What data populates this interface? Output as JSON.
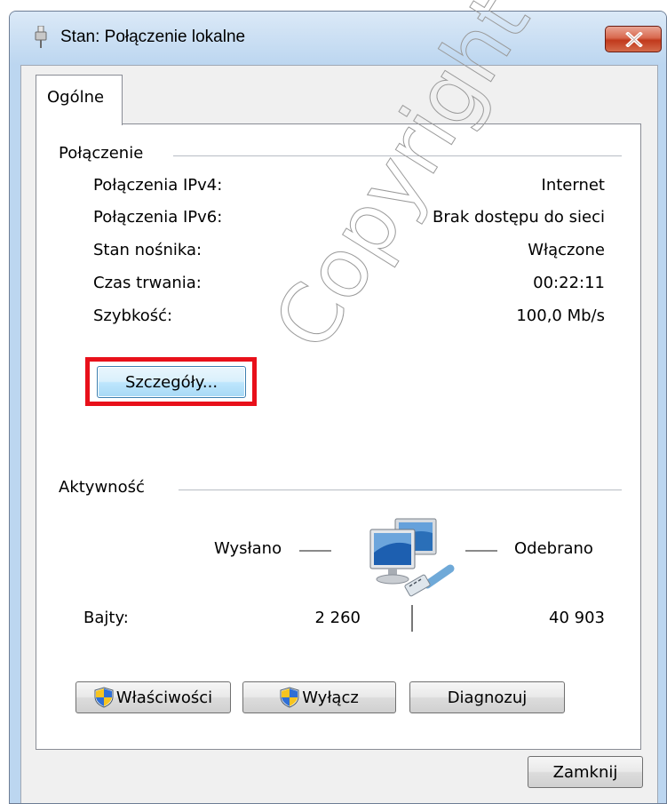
{
  "window": {
    "title": "Stan: Połączenie lokalne"
  },
  "tabs": [
    {
      "label": "Ogólne",
      "selected": true
    }
  ],
  "connection": {
    "group_title": "Połączenie",
    "rows": [
      {
        "label": "Połączenia IPv4:",
        "value": "Internet"
      },
      {
        "label": "Połączenia IPv6:",
        "value": "Brak dostępu do sieci"
      },
      {
        "label": "Stan nośnika:",
        "value": "Włączone"
      },
      {
        "label": "Czas trwania:",
        "value": "00:22:11"
      },
      {
        "label": "Szybkość:",
        "value": "100,0 Mb/s"
      }
    ],
    "details_button": "Szczegóły..."
  },
  "activity": {
    "group_title": "Aktywność",
    "sent_label": "Wysłano",
    "received_label": "Odebrano",
    "bytes_label": "Bajty:",
    "bytes_sent": "2 260",
    "bytes_received": "40 903",
    "icon": "network-computers-icon"
  },
  "buttons": {
    "properties": "Właściwości",
    "disable": "Wyłącz",
    "diagnose": "Diagnozuj",
    "close": "Zamknij"
  },
  "colors": {
    "highlight": "#e8101a",
    "close_button": "#c1391c",
    "window_frame": "#bcd6f0"
  }
}
